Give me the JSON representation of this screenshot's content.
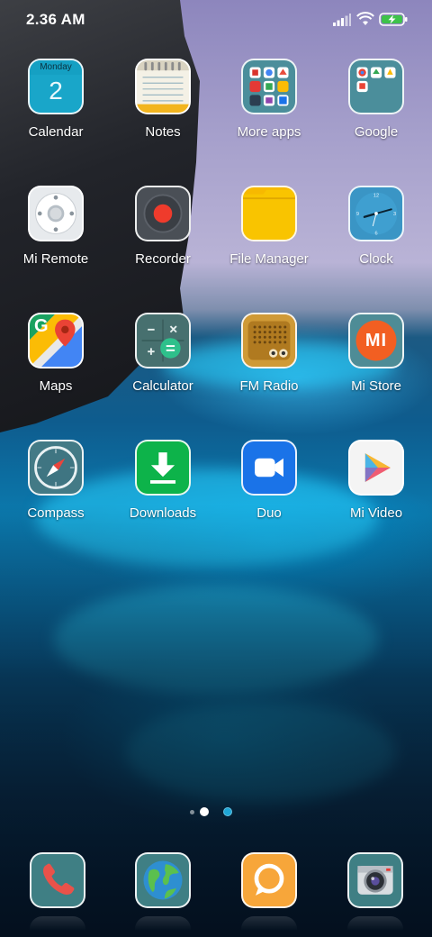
{
  "status_bar": {
    "time": "2.36 AM",
    "signal_icon": "cellular-signal-icon",
    "wifi_icon": "wifi-icon",
    "battery_icon": "battery-charging-icon",
    "battery_color": "#3ec24a"
  },
  "calendar_icon": {
    "weekday": "Monday",
    "day": "2"
  },
  "apps": [
    {
      "label": "Calendar"
    },
    {
      "label": "Notes"
    },
    {
      "label": "More apps"
    },
    {
      "label": "Google"
    },
    {
      "label": "Mi Remote"
    },
    {
      "label": "Recorder"
    },
    {
      "label": "File Manager"
    },
    {
      "label": "Clock"
    },
    {
      "label": "Maps"
    },
    {
      "label": "Calculator"
    },
    {
      "label": "FM Radio"
    },
    {
      "label": "Mi Store"
    },
    {
      "label": "Compass"
    },
    {
      "label": "Downloads"
    },
    {
      "label": "Duo"
    },
    {
      "label": "Mi Video"
    }
  ],
  "mi_store_logo_text": "MI",
  "maps_logo_text": "G",
  "page_indicator": {
    "current_page": 1,
    "total_pages": 2
  },
  "dock": [
    {
      "icon": "phone-icon"
    },
    {
      "icon": "browser-globe-icon"
    },
    {
      "icon": "messaging-icon"
    },
    {
      "icon": "camera-icon"
    }
  ]
}
